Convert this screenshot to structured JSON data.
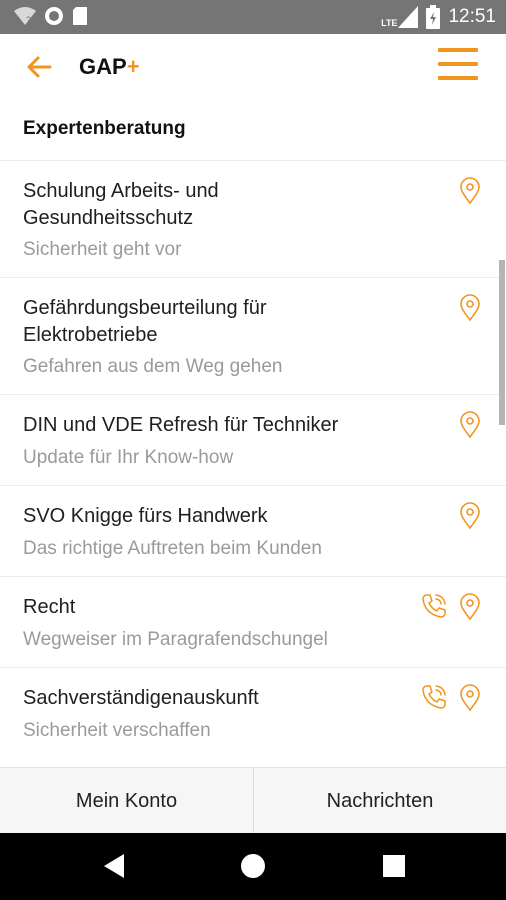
{
  "status_bar": {
    "time": "12:51",
    "network_label": "LTE",
    "icons": [
      "wifi-icon",
      "sync-icon",
      "sd-card-icon",
      "cell-signal-icon",
      "battery-icon"
    ]
  },
  "app_bar": {
    "title_main": "GAP",
    "title_plus": "+",
    "back_icon": "arrow-left-icon",
    "menu_icon": "hamburger-menu-icon"
  },
  "section_title": "Expertenberatung",
  "items": [
    {
      "title_line1": "Schulung Arbeits- und",
      "title_line2": "Gesundheitsschutz",
      "subtitle": "Sicherheit geht vor",
      "has_phone": false,
      "has_location": true
    },
    {
      "title_line1": "Gefährdungsbeurteilung für",
      "title_line2": "Elektrobetriebe",
      "subtitle": "Gefahren aus dem Weg gehen",
      "has_phone": false,
      "has_location": true
    },
    {
      "title_line1": "DIN und VDE Refresh für Techniker",
      "title_line2": "",
      "subtitle": "Update für Ihr Know-how",
      "has_phone": false,
      "has_location": true
    },
    {
      "title_line1": "SVO Knigge fürs Handwerk",
      "title_line2": "",
      "subtitle": "Das richtige Auftreten beim Kunden",
      "has_phone": false,
      "has_location": true
    },
    {
      "title_line1": "Recht",
      "title_line2": "",
      "subtitle": "Wegweiser im Paragrafendschungel",
      "has_phone": true,
      "has_location": true
    },
    {
      "title_line1": "Sachverständigenauskunft",
      "title_line2": "",
      "subtitle": "Sicherheit verschaffen",
      "has_phone": true,
      "has_location": true
    }
  ],
  "bottom_bar": {
    "account_label": "Mein Konto",
    "messages_label": "Nachrichten"
  },
  "colors": {
    "accent": "#f2951e",
    "status_bar": "#757575",
    "nav_bar": "#000000",
    "subtitle": "#9a9a9a"
  }
}
